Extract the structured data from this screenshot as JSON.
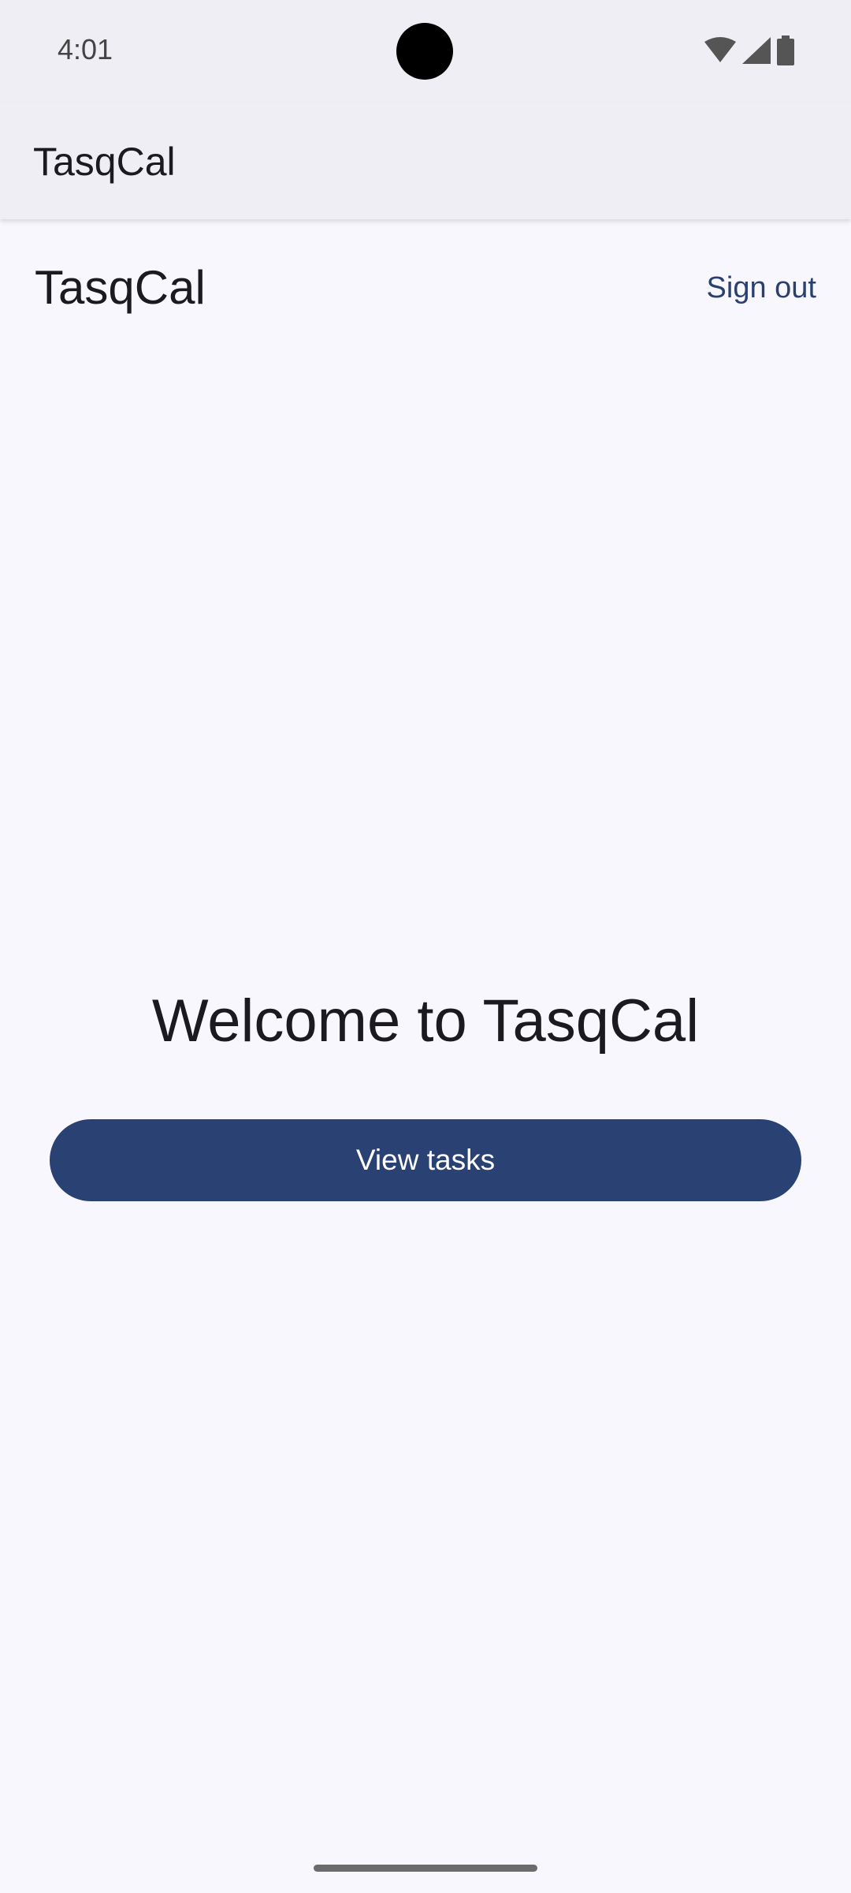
{
  "status_bar": {
    "time": "4:01",
    "icons": [
      "wifi-icon",
      "signal-icon",
      "battery-icon"
    ]
  },
  "app_bar": {
    "title": "TasqCal"
  },
  "header": {
    "title": "TasqCal",
    "sign_out_label": "Sign out"
  },
  "main": {
    "welcome_text": "Welcome to TasqCal",
    "view_tasks_label": "View tasks"
  },
  "colors": {
    "accent": "#2a4173",
    "background": "#f8f7fd",
    "app_bar_bg": "#efeef4"
  }
}
